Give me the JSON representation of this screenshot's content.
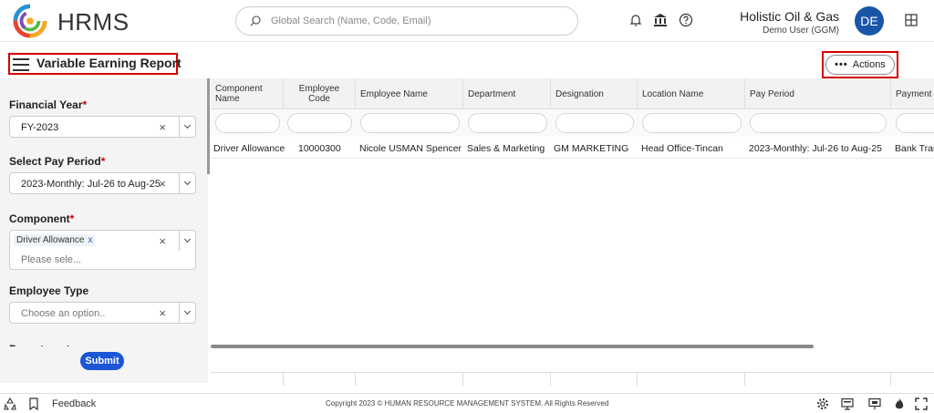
{
  "brand": {
    "name": "HRMS"
  },
  "search": {
    "placeholder": "Global Search (Name, Code, Email)"
  },
  "header": {
    "company": "Holistic Oil & Gas",
    "user": "Demo User (GGM)",
    "avatar_initials": "DE",
    "avatar_color": "#1a56a8"
  },
  "page": {
    "title": "Variable Earning Report",
    "actions_label": "Actions"
  },
  "filters": {
    "financial_year": {
      "label": "Financial Year",
      "value": "FY-2023"
    },
    "pay_period": {
      "label": "Select Pay Period",
      "value": "2023-Monthly: Jul-26 to Aug-25"
    },
    "component": {
      "label": "Component",
      "chip": "Driver Allowance",
      "chip_remove": "x",
      "placeholder": "Please sele..."
    },
    "employee_type": {
      "label": "Employee Type",
      "placeholder": "Choose an option.."
    },
    "department": {
      "label": "Department"
    },
    "required_mark": "*",
    "clear_symbol": "×",
    "submit_label": "Submit"
  },
  "table": {
    "columns": [
      "Component Name",
      "Employee Code",
      "Employee Name",
      "Department",
      "Designation",
      "Location Name",
      "Pay Period",
      "Payment"
    ],
    "rows": [
      [
        "Driver Allowance",
        "10000300",
        "Nicole USMAN Spencer",
        "Sales & Marketing",
        "GM MARKETING",
        "Head Office-Tincan",
        "2023-Monthly: Jul-26 to Aug-25",
        "Bank Tran"
      ]
    ]
  },
  "footer": {
    "feedback": "Feedback",
    "copyright": "Copyright 2023 © HUMAN RESOURCE MANAGEMENT SYSTEM. All Rights Reserved"
  },
  "colors": {
    "accent": "#1a56d6",
    "highlight_box": "#d40000"
  }
}
